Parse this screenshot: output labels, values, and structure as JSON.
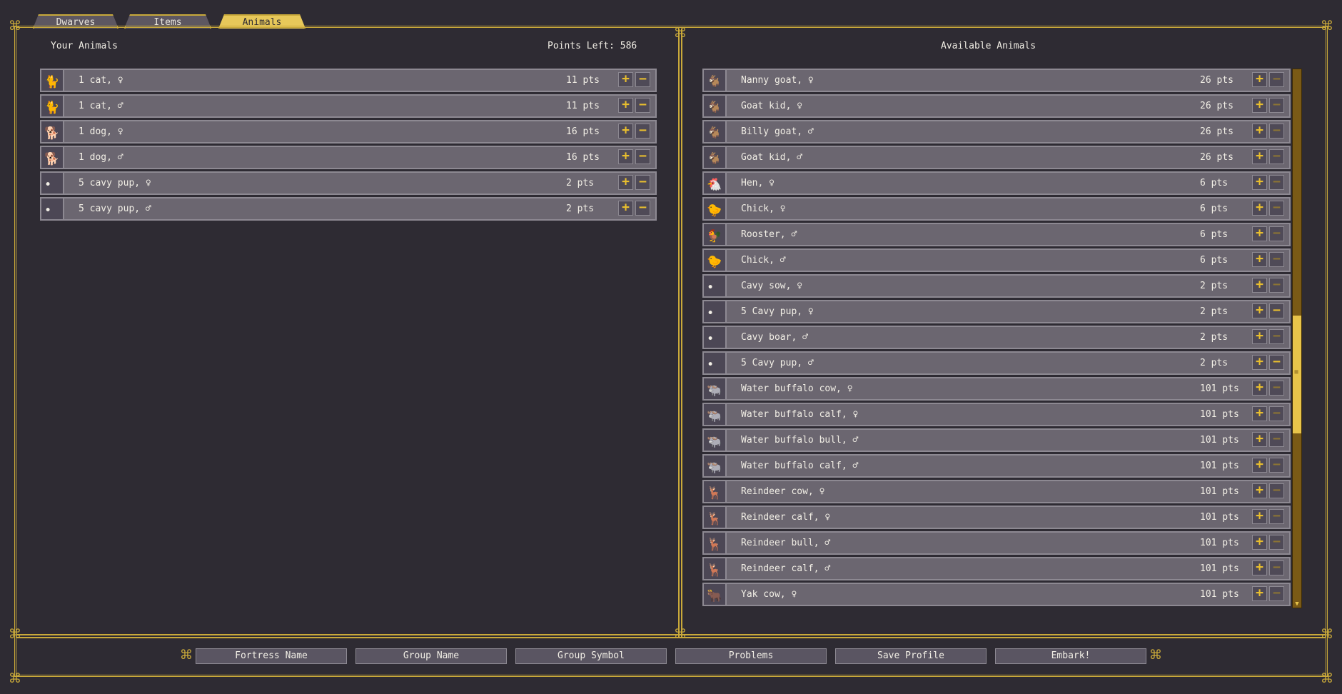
{
  "tabs": [
    {
      "label": "Dwarves",
      "active": false
    },
    {
      "label": "Items",
      "active": false
    },
    {
      "label": "Animals",
      "active": true
    }
  ],
  "left": {
    "title": "Your Animals",
    "points_label": "Points Left: 586",
    "rows": [
      {
        "icon": "cat-icon",
        "glyph": "🐈",
        "name": "1 cat, ♀",
        "pts": "11 pts"
      },
      {
        "icon": "cat-icon",
        "glyph": "🐈",
        "name": "1 cat, ♂",
        "pts": "11 pts"
      },
      {
        "icon": "dog-icon",
        "glyph": "🐕",
        "name": "1 dog, ♀",
        "pts": "16 pts"
      },
      {
        "icon": "dog-icon",
        "glyph": "🐕",
        "name": "1 dog, ♂",
        "pts": "16 pts"
      },
      {
        "icon": "cavy-icon",
        "glyph": "•",
        "name": "5 cavy pup, ♀",
        "pts": "2 pts"
      },
      {
        "icon": "cavy-icon",
        "glyph": "•",
        "name": "5 cavy pup, ♂",
        "pts": "2 pts"
      }
    ]
  },
  "right": {
    "title": "Available Animals",
    "rows": [
      {
        "icon": "goat-icon",
        "glyph": "🐐",
        "name": "Nanny goat, ♀",
        "pts": "26 pts",
        "minus_active": false
      },
      {
        "icon": "goat-kid-icon",
        "glyph": "🐐",
        "name": "Goat kid, ♀",
        "pts": "26 pts",
        "minus_active": false
      },
      {
        "icon": "goat-icon",
        "glyph": "🐐",
        "name": "Billy goat, ♂",
        "pts": "26 pts",
        "minus_active": false
      },
      {
        "icon": "goat-kid-icon",
        "glyph": "🐐",
        "name": "Goat kid, ♂",
        "pts": "26 pts",
        "minus_active": false
      },
      {
        "icon": "hen-icon",
        "glyph": "🐔",
        "name": "Hen, ♀",
        "pts": "6 pts",
        "minus_active": false
      },
      {
        "icon": "chick-icon",
        "glyph": "🐤",
        "name": "Chick, ♀",
        "pts": "6 pts",
        "minus_active": false
      },
      {
        "icon": "rooster-icon",
        "glyph": "🐓",
        "name": "Rooster, ♂",
        "pts": "6 pts",
        "minus_active": false
      },
      {
        "icon": "chick-icon",
        "glyph": "🐤",
        "name": "Chick, ♂",
        "pts": "6 pts",
        "minus_active": false
      },
      {
        "icon": "cavy-icon",
        "glyph": "•",
        "name": "Cavy sow, ♀",
        "pts": "2 pts",
        "minus_active": false
      },
      {
        "icon": "cavy-icon",
        "glyph": "•",
        "name": "5 Cavy pup, ♀",
        "pts": "2 pts",
        "minus_active": true
      },
      {
        "icon": "cavy-icon",
        "glyph": "•",
        "name": "Cavy boar, ♂",
        "pts": "2 pts",
        "minus_active": false
      },
      {
        "icon": "cavy-icon",
        "glyph": "•",
        "name": "5 Cavy pup, ♂",
        "pts": "2 pts",
        "minus_active": true
      },
      {
        "icon": "water-buffalo-icon",
        "glyph": "🐃",
        "name": "Water buffalo cow, ♀",
        "pts": "101 pts",
        "minus_active": false
      },
      {
        "icon": "water-buffalo-icon",
        "glyph": "🐃",
        "name": "Water buffalo calf, ♀",
        "pts": "101 pts",
        "minus_active": false
      },
      {
        "icon": "water-buffalo-icon",
        "glyph": "🐃",
        "name": "Water buffalo bull, ♂",
        "pts": "101 pts",
        "minus_active": false
      },
      {
        "icon": "water-buffalo-icon",
        "glyph": "🐃",
        "name": "Water buffalo calf, ♂",
        "pts": "101 pts",
        "minus_active": false
      },
      {
        "icon": "reindeer-icon",
        "glyph": "🦌",
        "name": "Reindeer cow, ♀",
        "pts": "101 pts",
        "minus_active": false
      },
      {
        "icon": "reindeer-icon",
        "glyph": "🦌",
        "name": "Reindeer calf, ♀",
        "pts": "101 pts",
        "minus_active": false
      },
      {
        "icon": "reindeer-icon",
        "glyph": "🦌",
        "name": "Reindeer bull, ♂",
        "pts": "101 pts",
        "minus_active": false
      },
      {
        "icon": "reindeer-icon",
        "glyph": "🦌",
        "name": "Reindeer calf, ♂",
        "pts": "101 pts",
        "minus_active": false
      },
      {
        "icon": "yak-icon",
        "glyph": "🐂",
        "name": "Yak cow, ♀",
        "pts": "101 pts",
        "minus_active": false
      }
    ]
  },
  "buttons": {
    "plus": "+",
    "minus": "−"
  },
  "bottom": [
    {
      "id": "fortress-name-button",
      "label": "Fortress Name"
    },
    {
      "id": "group-name-button",
      "label": "Group Name"
    },
    {
      "id": "group-symbol-button",
      "label": "Group Symbol"
    },
    {
      "id": "problems-button",
      "label": "Problems"
    },
    {
      "id": "save-profile-button",
      "label": "Save Profile"
    },
    {
      "id": "embark-button",
      "label": "Embark!"
    }
  ],
  "colors": {
    "background": "#2e2b33",
    "frame_gold": "#c9a93a",
    "row": "#6b6670",
    "button_plus": "#e8be2e",
    "tab_active": "#e7c85a"
  }
}
